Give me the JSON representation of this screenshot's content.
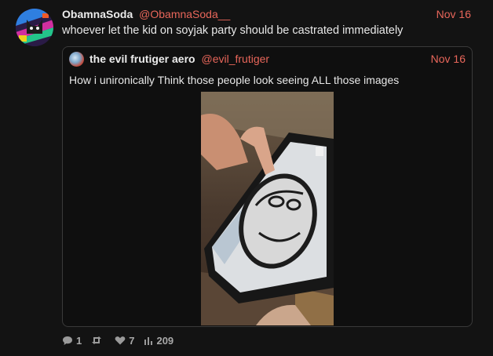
{
  "post": {
    "author_name": "ObamnaSoda",
    "author_handle": "@ObamnaSoda__",
    "date": "Nov 16",
    "text": "whoever let the kid on soyjak party should be castrated immediately"
  },
  "quoted": {
    "author_name": "the evil frutiger aero",
    "author_handle": "@evil_frutiger",
    "date": "Nov 16",
    "text": "How i unironically Think those people look seeing ALL those images"
  },
  "stats": {
    "replies": "1",
    "reposts": "",
    "likes": "7",
    "views": "209"
  },
  "colors": {
    "accent": "#e8665a",
    "background": "#131313"
  }
}
